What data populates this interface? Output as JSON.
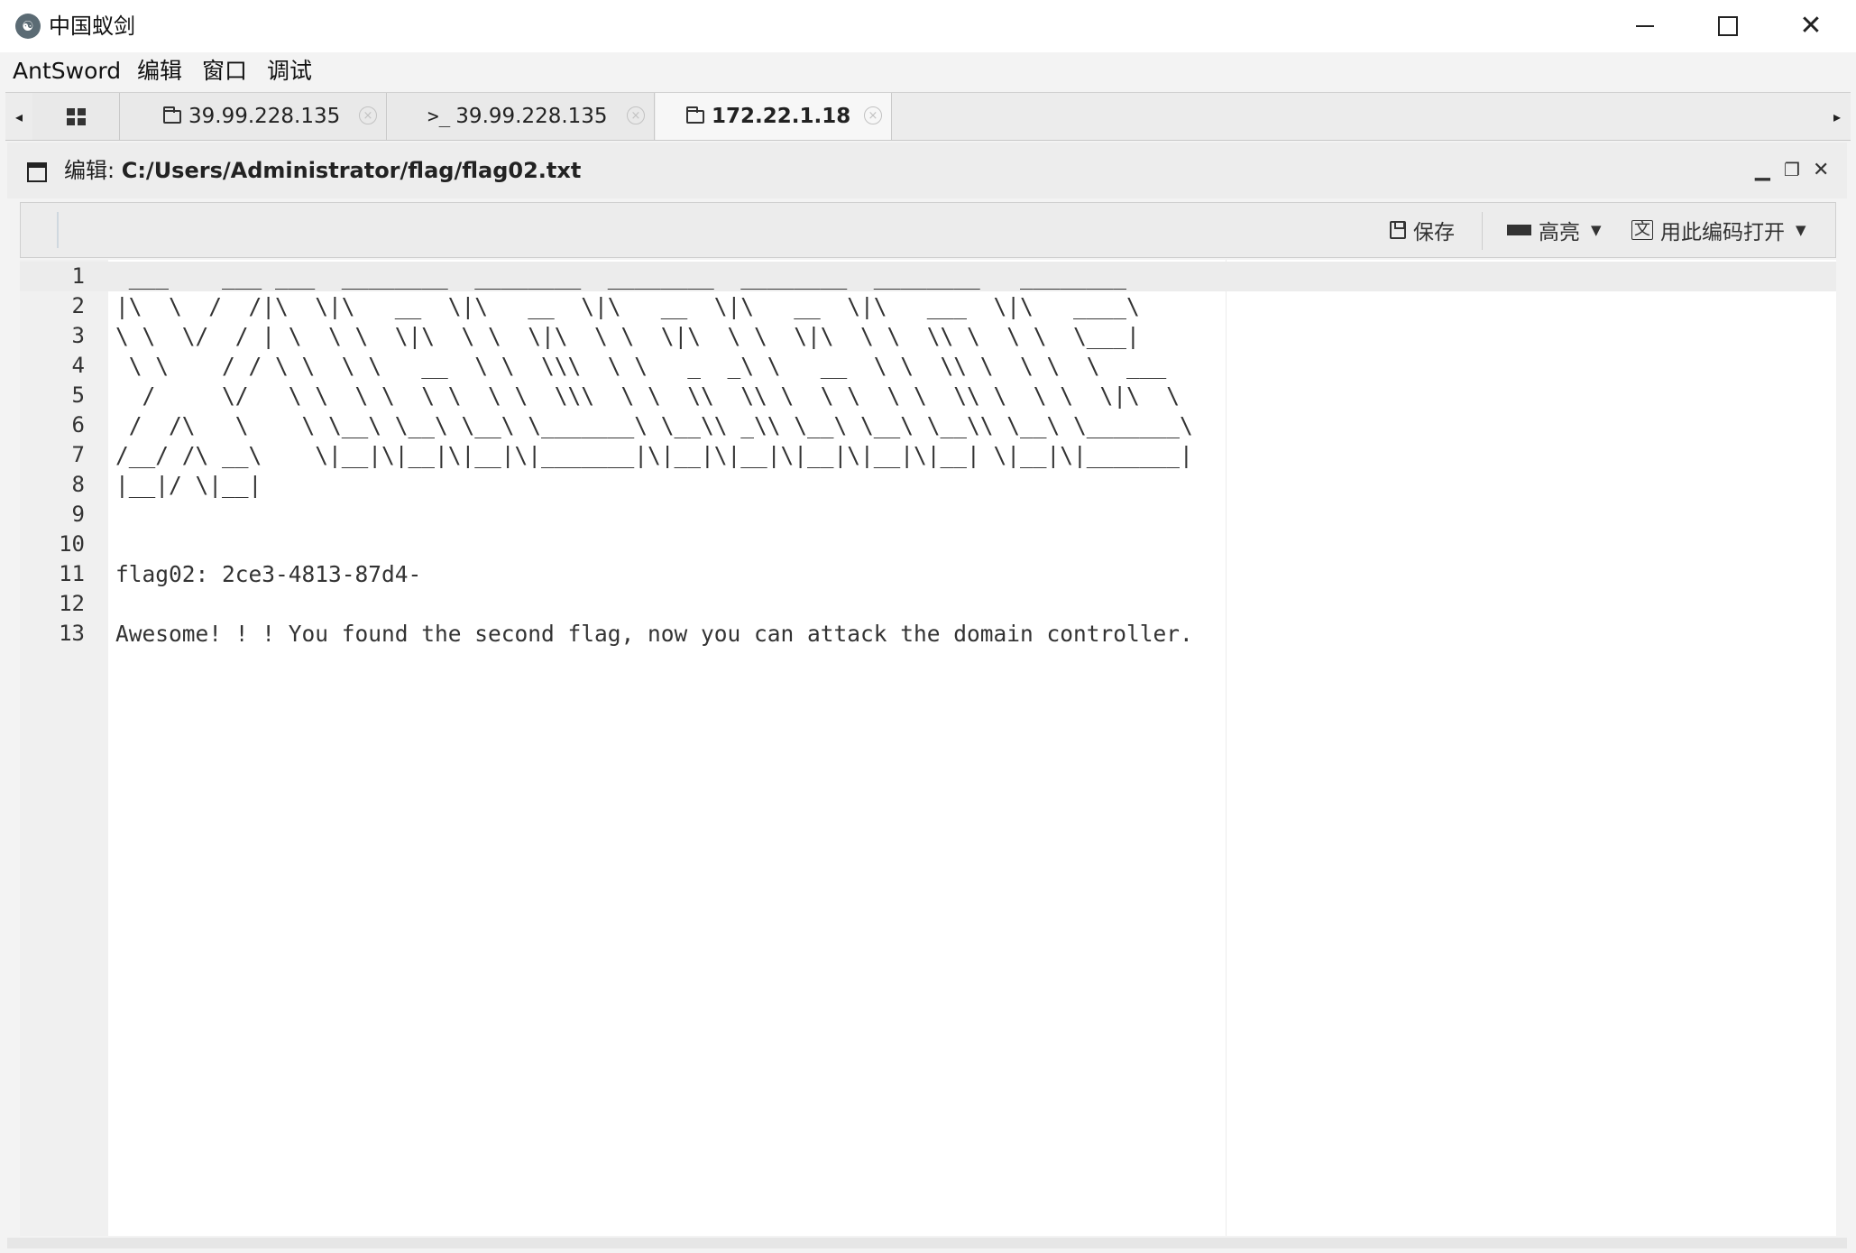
{
  "window": {
    "app_logo_glyph": "☯",
    "title": "中国蚁剑",
    "minimize_glyph": "",
    "maximize_glyph": "",
    "close_glyph": "✕"
  },
  "menu": [
    "AntSword",
    "编辑",
    "窗口",
    "调试"
  ],
  "tabs": [
    {
      "type": "files",
      "label": "39.99.228.135",
      "close": "×"
    },
    {
      "type": "terminal",
      "icon_text": ">_",
      "label": "39.99.228.135",
      "close": "×"
    },
    {
      "type": "files",
      "label": "172.22.1.18",
      "close": "×",
      "active": true
    }
  ],
  "tab_arrows": {
    "left": "◂",
    "right": "▸"
  },
  "panel": {
    "title_prefix": "编辑: ",
    "file_path": "C:/Users/Administrator/flag/flag02.txt",
    "min_glyph": "▁",
    "restore_glyph": "❐",
    "close_glyph": "✕"
  },
  "toolbar": {
    "save_label": "保存",
    "highlight_label": "高亮",
    "encoding_label": "用此编码打开",
    "encoding_icon_text": "文",
    "caret": "▼"
  },
  "editor": {
    "line_numbers": [
      "1",
      "2",
      "3",
      "4",
      "5",
      "6",
      "7",
      "8",
      "9",
      "10",
      "11",
      "12",
      "13"
    ],
    "lines": [
      " ___    ___ ___  ________  ________  ________  ________  ________   ________",
      "|\\  \\  /  /|\\  \\|\\   __  \\|\\   __  \\|\\   __  \\|\\   __  \\|\\   ___  \\|\\   ____\\",
      "\\ \\  \\/  / | \\  \\ \\  \\|\\  \\ \\  \\|\\  \\ \\  \\|\\  \\ \\  \\|\\  \\ \\  \\\\ \\  \\ \\  \\___|",
      " \\ \\    / / \\ \\  \\ \\   __  \\ \\  \\\\\\  \\ \\   _  _\\ \\   __  \\ \\  \\\\ \\  \\ \\  \\  ___",
      "  /     \\/   \\ \\  \\ \\  \\ \\  \\ \\  \\\\\\  \\ \\  \\\\  \\\\ \\  \\ \\  \\ \\  \\\\ \\  \\ \\  \\|\\  \\",
      " /  /\\   \\    \\ \\__\\ \\__\\ \\__\\ \\_______\\ \\__\\\\ _\\\\ \\__\\ \\__\\ \\__\\\\ \\__\\ \\_______\\",
      "/__/ /\\ __\\    \\|__|\\|__|\\|__|\\|_______|\\|__|\\|__|\\|__|\\|__|\\|__| \\|__|\\|_______|",
      "|__|/ \\|__|",
      "",
      "",
      "flag02: 2ce3-4813-87d4-",
      "",
      "Awesome! ! ! You found the second flag, now you can attack the domain controller."
    ]
  }
}
